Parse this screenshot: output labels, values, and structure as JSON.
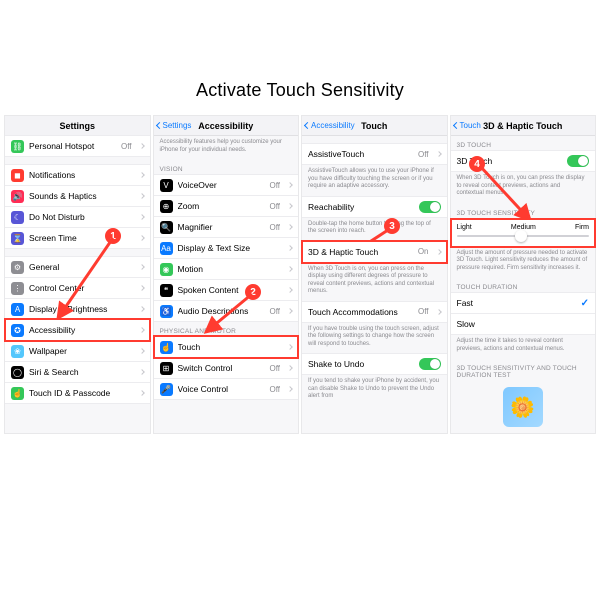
{
  "title": "Activate Touch Sensitivity",
  "panel1": {
    "header": "Settings",
    "rows1": [
      {
        "icon": "#34c759",
        "glyph": "⛓",
        "label": "Personal Hotspot",
        "val": "Off"
      }
    ],
    "rows2": [
      {
        "icon": "#ff3b30",
        "glyph": "◼",
        "label": "Notifications"
      },
      {
        "icon": "#ff2d55",
        "glyph": "🔊",
        "label": "Sounds & Haptics"
      },
      {
        "icon": "#5856d6",
        "glyph": "☾",
        "label": "Do Not Disturb"
      },
      {
        "icon": "#5856d6",
        "glyph": "⌛",
        "label": "Screen Time"
      }
    ],
    "rows3": [
      {
        "icon": "#8e8e93",
        "glyph": "⚙",
        "label": "General"
      },
      {
        "icon": "#8e8e93",
        "glyph": "⋮",
        "label": "Control Center"
      },
      {
        "icon": "#0a7aff",
        "glyph": "A",
        "label": "Display & Brightness"
      },
      {
        "icon": "#0a7aff",
        "glyph": "✪",
        "label": "Accessibility",
        "highlight": true
      },
      {
        "icon": "#54c7fc",
        "glyph": "❀",
        "label": "Wallpaper"
      },
      {
        "icon": "#000",
        "glyph": "◯",
        "label": "Siri & Search"
      },
      {
        "icon": "#34c759",
        "glyph": "☝",
        "label": "Touch ID & Passcode"
      }
    ]
  },
  "panel2": {
    "back": "Settings",
    "header": "Accessibility",
    "desc": "Accessibility features help you customize your iPhone for your individual needs.",
    "sec1": "VISION",
    "rows1": [
      {
        "icon": "#000",
        "glyph": "V",
        "label": "VoiceOver",
        "val": "Off"
      },
      {
        "icon": "#000",
        "glyph": "⊕",
        "label": "Zoom",
        "val": "Off"
      },
      {
        "icon": "#000",
        "glyph": "🔍",
        "label": "Magnifier",
        "val": "Off"
      },
      {
        "icon": "#0a7aff",
        "glyph": "Aa",
        "label": "Display & Text Size"
      },
      {
        "icon": "#34c759",
        "glyph": "◉",
        "label": "Motion"
      },
      {
        "icon": "#000",
        "glyph": "❝",
        "label": "Spoken Content"
      },
      {
        "icon": "#0a7aff",
        "glyph": "♿",
        "label": "Audio Descriptions",
        "val": "Off"
      }
    ],
    "sec2": "PHYSICAL AND MOTOR",
    "rows2": [
      {
        "icon": "#0a7aff",
        "glyph": "☝",
        "label": "Touch",
        "highlight": true
      },
      {
        "icon": "#000",
        "glyph": "⊞",
        "label": "Switch Control",
        "val": "Off"
      },
      {
        "icon": "#0a7aff",
        "glyph": "🎤",
        "label": "Voice Control",
        "val": "Off"
      }
    ]
  },
  "panel3": {
    "back": "Accessibility",
    "header": "Touch",
    "r1_label": "AssistiveTouch",
    "r1_val": "Off",
    "d1": "AssistiveTouch allows you to use your iPhone if you have difficulty touching the screen or if you require an adaptive accessory.",
    "r2_label": "Reachability",
    "d2": "Double-tap the home button to bring the top of the screen into reach.",
    "r3_label": "3D & Haptic Touch",
    "r3_val": "On",
    "d3": "When 3D Touch is on, you can press on the display using different degrees of pressure to reveal content previews, actions and contextual menus.",
    "r4_label": "Touch Accommodations",
    "r4_val": "Off",
    "d4": "If you have trouble using the touch screen, adjust the following settings to change how the screen will respond to touches.",
    "r5_label": "Shake to Undo",
    "d5": "If you tend to shake your iPhone by accident, you can disable Shake to Undo to prevent the Undo alert from"
  },
  "panel4": {
    "back": "Touch",
    "header": "3D & Haptic Touch",
    "sec1": "3D TOUCH",
    "r1_label": "3D Touch",
    "d1": "When 3D Touch is on, you can press the display to reveal content previews, actions and contextual menus.",
    "sec2": "3D TOUCH SENSITIVITY",
    "s_light": "Light",
    "s_med": "Medium",
    "s_firm": "Firm",
    "d2": "Adjust the amount of pressure needed to activate 3D Touch. Light sensitivity reduces the amount of pressure required. Firm sensitivity increases it.",
    "sec3": "TOUCH DURATION",
    "r2_label": "Fast",
    "r3_label": "Slow",
    "d3": "Adjust the time it takes to reveal content previews, actions and contextual menus.",
    "sec4": "3D TOUCH SENSITIVITY AND TOUCH DURATION TEST"
  },
  "badges": {
    "b1": "1",
    "b2": "2",
    "b3": "3",
    "b4": "4"
  }
}
